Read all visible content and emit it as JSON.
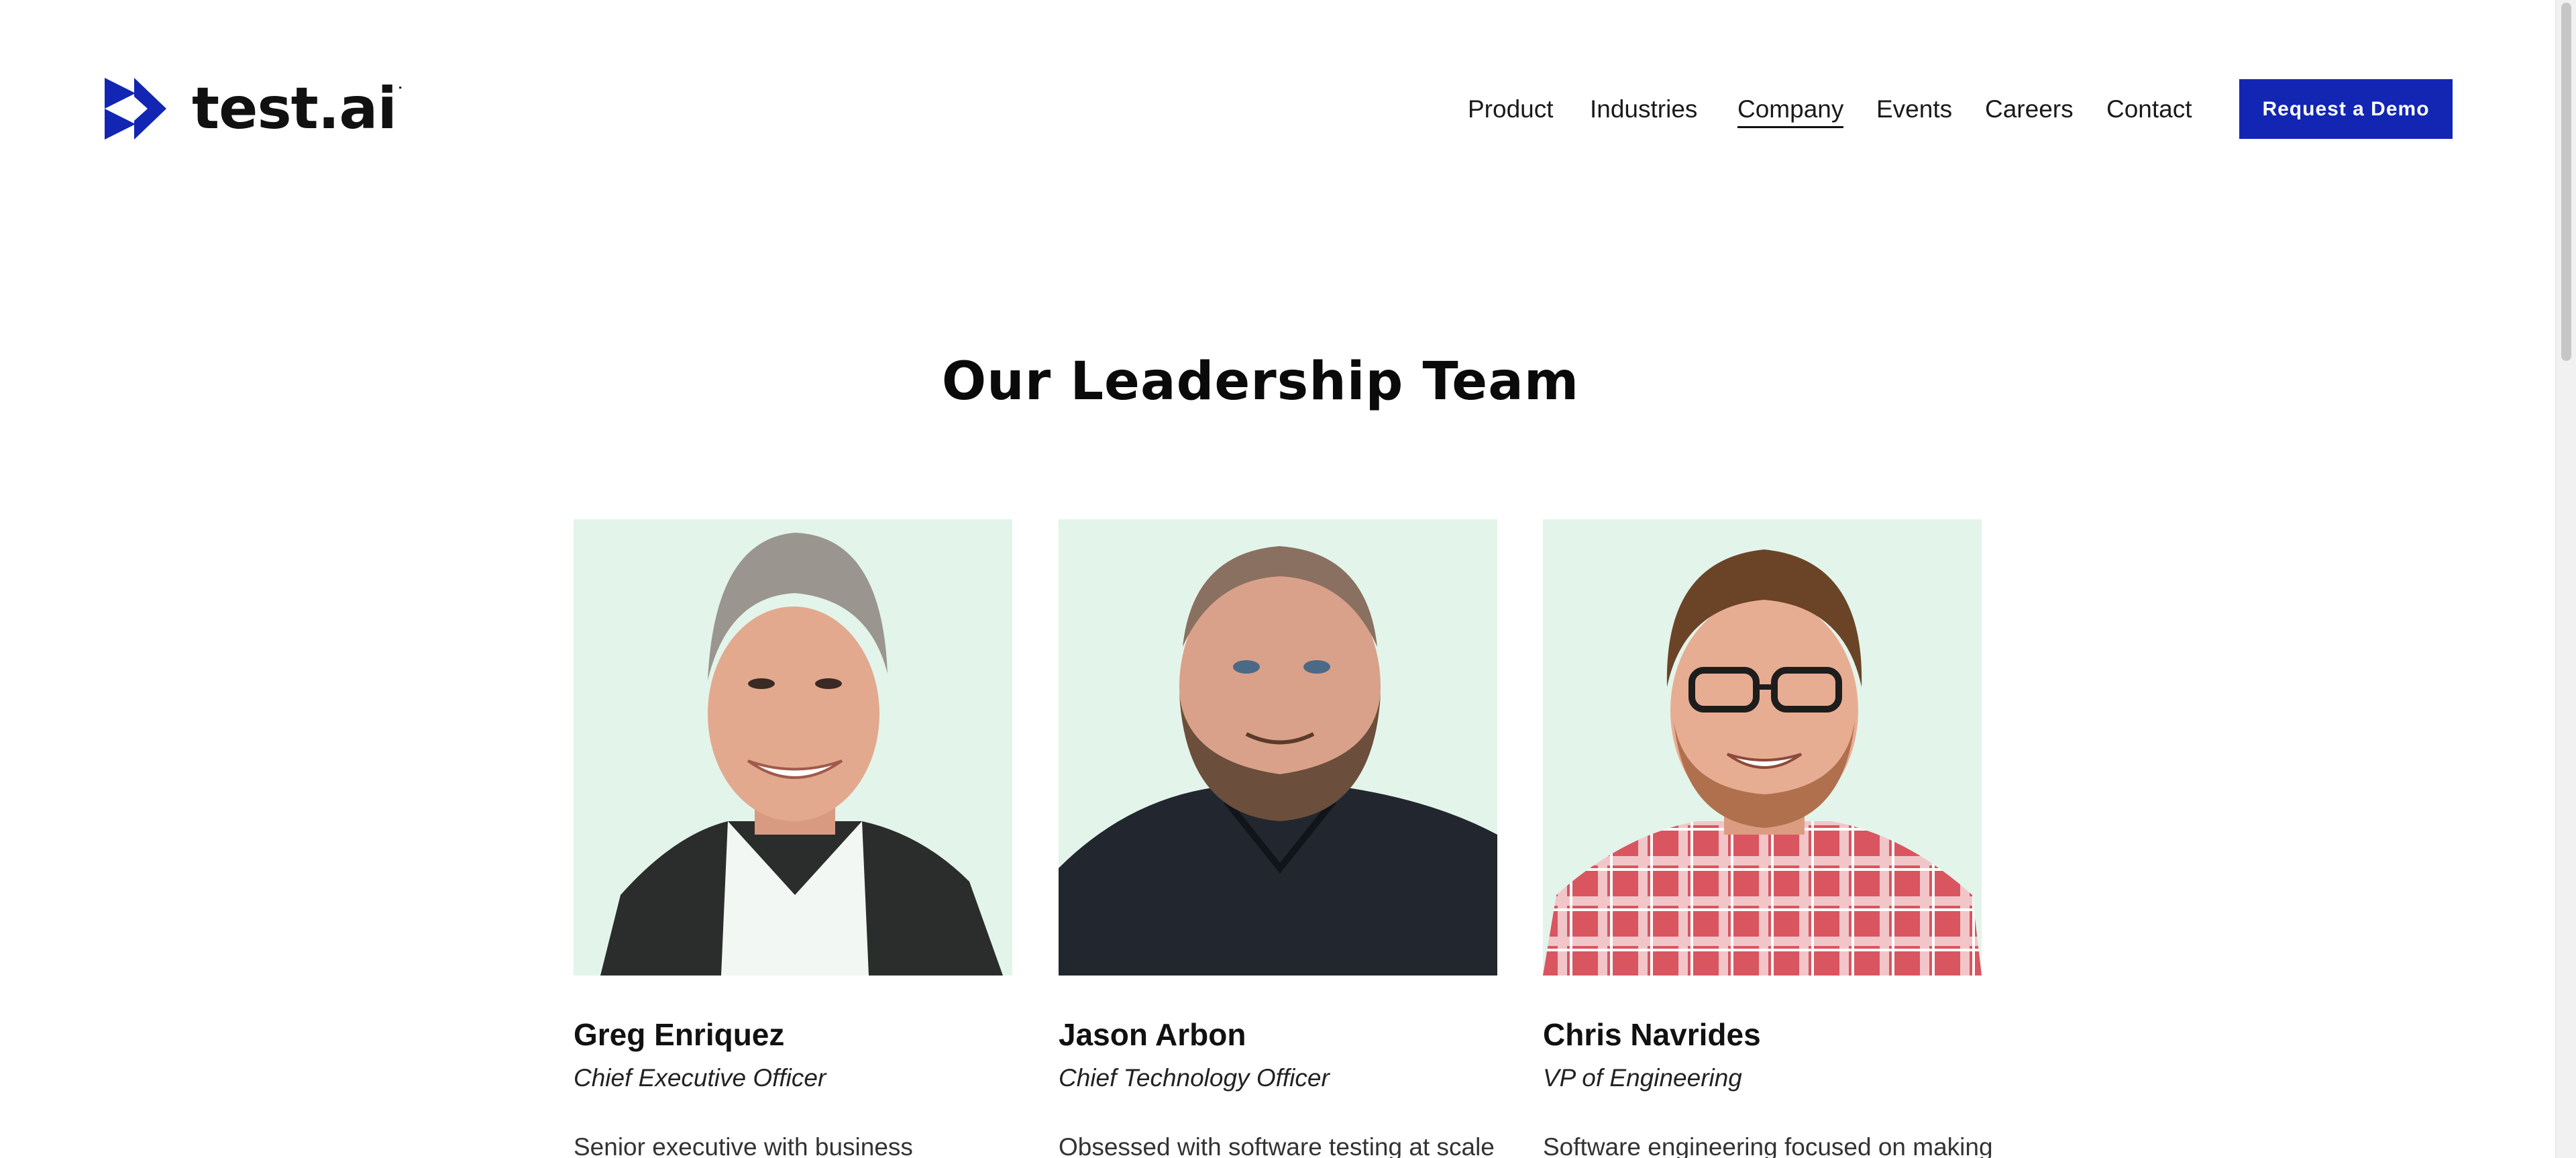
{
  "brand": {
    "logo_text": "test.ai",
    "logo_mark": "ᐧ",
    "accent_color": "#1226b3"
  },
  "nav": {
    "items": [
      {
        "label": "Product"
      },
      {
        "label": "Industries"
      },
      {
        "label": "Company",
        "active": true
      },
      {
        "label": "Events"
      },
      {
        "label": "Careers"
      },
      {
        "label": "Contact"
      }
    ],
    "cta_label": "Request a Demo"
  },
  "section": {
    "title": "Our Leadership Team"
  },
  "team": [
    {
      "name": "Greg Enriquez",
      "role": "Chief Executive Officer",
      "bio": "Senior executive with business",
      "photo_icon": "portrait-greg-enriquez"
    },
    {
      "name": "Jason Arbon",
      "role": "Chief Technology Officer",
      "bio": "Obsessed with software testing at scale",
      "photo_icon": "portrait-jason-arbon"
    },
    {
      "name": "Chris Navrides",
      "role": "VP of Engineering",
      "bio": "Software engineering focused on making",
      "photo_icon": "portrait-chris-navrides"
    }
  ]
}
